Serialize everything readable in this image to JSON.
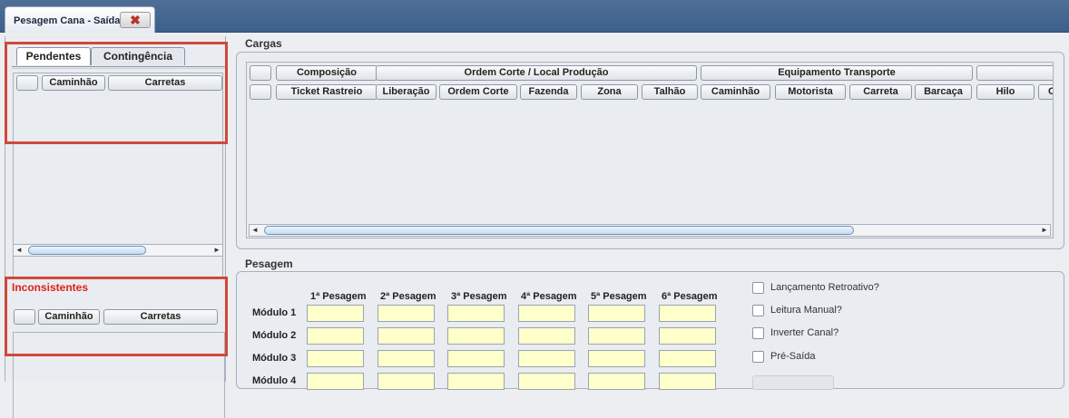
{
  "window": {
    "tab_title": "Pesagem Cana - Saída",
    "close_glyph": "✖"
  },
  "left_panel": {
    "tabs": [
      {
        "label": "Pendentes",
        "active": true
      },
      {
        "label": "Contingência",
        "active": false
      }
    ],
    "pendentes_columns": [
      "",
      "Caminhão",
      "Carretas"
    ],
    "inconsistentes_title": "Inconsistentes",
    "inconsistentes_columns": [
      "",
      "Caminhão",
      "Carretas"
    ]
  },
  "cargas": {
    "title": "Cargas",
    "group_headers": [
      "",
      "Composição",
      "Ordem Corte / Local Produção",
      "Equipamento Transporte",
      ""
    ],
    "columns": [
      "",
      "Ticket Rastreio",
      "Liberação",
      "Ordem Corte",
      "Fazenda",
      "Zona",
      "Talhão",
      "Caminhão",
      "Motorista",
      "Carreta",
      "Barcaça",
      "Hilo",
      "C"
    ]
  },
  "pesagem": {
    "title": "Pesagem",
    "column_headers": [
      "1ª Pesagem",
      "2ª Pesagem",
      "3ª Pesagem",
      "4ª Pesagem",
      "5ª Pesagem",
      "6ª Pesagem"
    ],
    "rows": [
      "Módulo 1",
      "Módulo 2",
      "Módulo 3",
      "Módulo 4"
    ],
    "options": [
      {
        "label": "Lançamento Retroativo?",
        "checked": false
      },
      {
        "label": "Leitura Manual?",
        "checked": false
      },
      {
        "label": "Inverter Canal?",
        "checked": false
      },
      {
        "label": "Pré-Saída",
        "checked": false
      }
    ]
  },
  "colors": {
    "topbar": "#3d5f8c",
    "input_fill": "#ffffcc",
    "highlight_box": "#d0483a",
    "alert_text": "#e0201a"
  },
  "icons": [
    "close-icon",
    "scroll-left-icon",
    "scroll-right-icon"
  ]
}
